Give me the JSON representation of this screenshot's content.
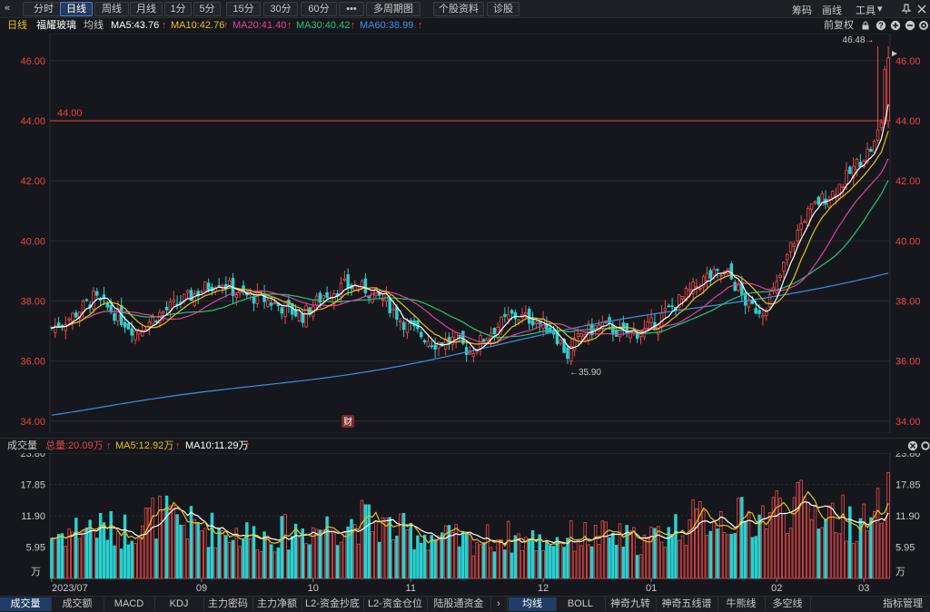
{
  "toolbar": {
    "collapse_icon": "«",
    "periods": [
      "分时",
      "日线",
      "周线",
      "月线",
      "1分",
      "5分",
      "15分",
      "30分",
      "60分",
      "•••",
      "多周期图",
      "个股资料",
      "诊股"
    ],
    "active_period": "日线",
    "right_items": [
      "筹码",
      "画线",
      "工具"
    ],
    "tools_arrow": "▾",
    "window_controls": [
      "pin-icon",
      "close-icon"
    ]
  },
  "info": {
    "mode": "日线",
    "stock_name": "福耀玻璃",
    "ma_label": "均线",
    "ma": [
      {
        "label": "MA5:43.76",
        "color": "#ffffff"
      },
      {
        "label": "MA10:42.76",
        "color": "#e7c21a"
      },
      {
        "label": "MA20:41.40",
        "color": "#e0409a"
      },
      {
        "label": "MA30:40.42",
        "color": "#23c47a"
      },
      {
        "label": "MA60:38.99",
        "color": "#3d8ee6"
      }
    ],
    "up_arrow": "↑",
    "adjust": "前复权",
    "header_icons": [
      "lock-icon",
      "question-icon",
      "zoom-in-icon",
      "zoom-out-icon",
      "settings-icon"
    ]
  },
  "volume_header": {
    "title": "成交量",
    "total": "总量:20.09万",
    "ma5": "MA5:12.92万",
    "ma10": "MA10:11.29万",
    "up_arrow": "↑",
    "colors": {
      "total": "#e84545",
      "ma5": "#e7c21a",
      "ma10": "#ffffff"
    }
  },
  "tabs": {
    "left": [
      "成交量",
      "成交额",
      "MACD",
      "KDJ",
      "主力密码",
      "主力净额",
      "L2-资金抄底",
      "L2-资金仓位",
      "陆股通资金"
    ],
    "left_active": "成交量",
    "arrow": "›",
    "right": [
      "均线",
      "BOLL",
      "神奇九转",
      "神奇五线谱",
      "牛熊线",
      "多空线"
    ],
    "right_active": "均线",
    "manage": "指标管理"
  },
  "colors": {
    "up": "#ef4b4b",
    "down": "#2ad0d0",
    "price_axis": "#e84545",
    "grid": "#2a2c33",
    "hline": "#e84545"
  },
  "chart_data": {
    "type": "candlestick",
    "title": "福耀玻璃",
    "price_axis": {
      "ticks": [
        "34.00",
        "36.00",
        "38.00",
        "40.00",
        "42.00",
        "44.00",
        "46.00"
      ],
      "ylim": [
        33.6,
        46.9
      ]
    },
    "volume_axis": {
      "ticks": [
        "23.80",
        "17.85",
        "11.90",
        "5.95"
      ],
      "unit": "万",
      "ylim": [
        0,
        23.8
      ]
    },
    "x_labels": [
      "2023/07",
      "09",
      "10",
      "11",
      "12",
      "01",
      "02",
      "03"
    ],
    "x_label_index": [
      0,
      43,
      75,
      103,
      141,
      172,
      208,
      233
    ],
    "hline": {
      "value": 44.0,
      "label": "44.00"
    },
    "annotations": [
      {
        "text": "46.48→",
        "value": 46.48,
        "index": 237
      },
      {
        "text": "←35.90",
        "value": 35.9,
        "index": 148
      },
      {
        "text": "财",
        "index": 85
      }
    ],
    "ma_current": {
      "MA5": 43.76,
      "MA10": 42.76,
      "MA20": 41.4,
      "MA30": 40.42,
      "MA60": 38.99
    },
    "volume_current": {
      "total": 20.09,
      "MA5": 12.92,
      "MA10": 11.29
    },
    "close_anchors": [
      [
        0,
        37.1
      ],
      [
        6,
        37.5
      ],
      [
        12,
        38.1
      ],
      [
        18,
        37.6
      ],
      [
        24,
        37.0
      ],
      [
        30,
        37.5
      ],
      [
        36,
        37.9
      ],
      [
        42,
        38.3
      ],
      [
        48,
        38.7
      ],
      [
        54,
        38.2
      ],
      [
        60,
        38.1
      ],
      [
        66,
        37.8
      ],
      [
        72,
        37.5
      ],
      [
        78,
        38.2
      ],
      [
        84,
        38.5
      ],
      [
        90,
        38.4
      ],
      [
        96,
        38.0
      ],
      [
        100,
        37.4
      ],
      [
        104,
        37.0
      ],
      [
        110,
        36.6
      ],
      [
        116,
        36.7
      ],
      [
        120,
        36.3
      ],
      [
        126,
        37.0
      ],
      [
        132,
        37.5
      ],
      [
        138,
        37.4
      ],
      [
        144,
        37.0
      ],
      [
        148,
        36.2
      ],
      [
        152,
        36.9
      ],
      [
        158,
        37.2
      ],
      [
        164,
        36.9
      ],
      [
        170,
        37.0
      ],
      [
        176,
        37.6
      ],
      [
        182,
        38.2
      ],
      [
        188,
        38.8
      ],
      [
        194,
        38.9
      ],
      [
        200,
        37.8
      ],
      [
        204,
        37.7
      ],
      [
        208,
        38.5
      ],
      [
        212,
        39.8
      ],
      [
        216,
        40.8
      ],
      [
        220,
        41.3
      ],
      [
        224,
        41.6
      ],
      [
        228,
        42.1
      ],
      [
        232,
        42.7
      ],
      [
        236,
        43.2
      ],
      [
        238,
        44.0
      ],
      [
        239,
        45.7
      ],
      [
        240,
        46.1
      ]
    ],
    "volume_anchors": [
      [
        0,
        8
      ],
      [
        10,
        10
      ],
      [
        20,
        9
      ],
      [
        30,
        12
      ],
      [
        40,
        10
      ],
      [
        50,
        9
      ],
      [
        60,
        8
      ],
      [
        70,
        9
      ],
      [
        80,
        10
      ],
      [
        90,
        11
      ],
      [
        100,
        9
      ],
      [
        110,
        8
      ],
      [
        120,
        7
      ],
      [
        130,
        8
      ],
      [
        140,
        7
      ],
      [
        150,
        8
      ],
      [
        160,
        8
      ],
      [
        170,
        7
      ],
      [
        180,
        10
      ],
      [
        190,
        12
      ],
      [
        200,
        11
      ],
      [
        210,
        14
      ],
      [
        220,
        13
      ],
      [
        230,
        11
      ],
      [
        236,
        10
      ],
      [
        240,
        20.09
      ]
    ],
    "candle_count": 241
  }
}
